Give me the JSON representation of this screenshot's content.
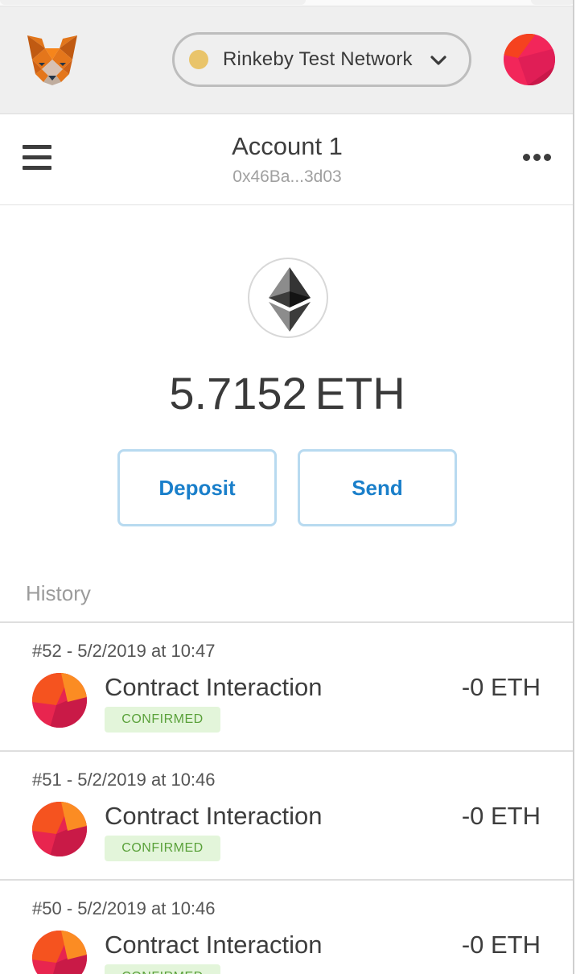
{
  "header": {
    "network": {
      "label": "Rinkeby Test Network",
      "dot_color": "#e9c46a"
    },
    "logo_icon": "metamask-fox-icon",
    "avatar_icon": "account-identicon"
  },
  "account": {
    "name": "Account 1",
    "address": "0x46Ba...3d03",
    "menu_icon": "hamburger-icon",
    "more_icon": "more-options-icon"
  },
  "balance": {
    "amount": "5.7152",
    "unit": "ETH",
    "token_icon": "ethereum-icon"
  },
  "actions": {
    "deposit_label": "Deposit",
    "send_label": "Send",
    "accent_color": "#1a7fca"
  },
  "history": {
    "label": "History",
    "transactions": [
      {
        "date": "#52 - 5/2/2019 at 10:47",
        "title": "Contract Interaction",
        "status": "CONFIRMED",
        "amount": "-0 ETH"
      },
      {
        "date": "#51 - 5/2/2019 at 10:46",
        "title": "Contract Interaction",
        "status": "CONFIRMED",
        "amount": "-0 ETH"
      },
      {
        "date": "#50 - 5/2/2019 at 10:46",
        "title": "Contract Interaction",
        "status": "CONFIRMED",
        "amount": "-0 ETH"
      }
    ]
  }
}
